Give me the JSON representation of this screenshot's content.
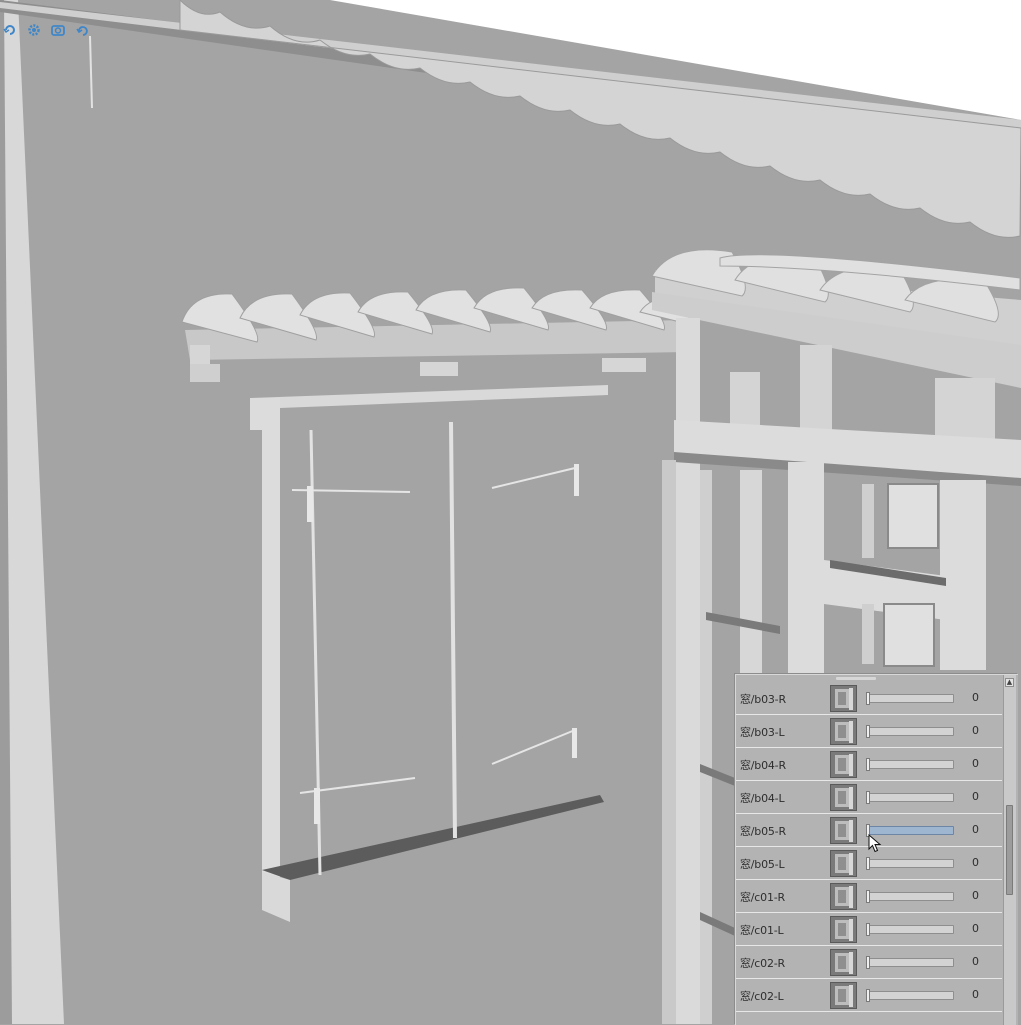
{
  "toolbar": {
    "icons": [
      "rotate-icon",
      "gear-icon",
      "camera-icon",
      "undo-icon"
    ]
  },
  "colors": {
    "accent": "#3f86c9",
    "slider_hover": "#9fb6d1",
    "wall": "#a4a4a4",
    "trim": "#dadada"
  },
  "morph_panel": {
    "items": [
      {
        "label": "窓/b03-R",
        "value": "0",
        "level": 0
      },
      {
        "label": "窓/b03-L",
        "value": "0",
        "level": 0
      },
      {
        "label": "窓/b04-R",
        "value": "0",
        "level": 0
      },
      {
        "label": "窓/b04-L",
        "value": "0",
        "level": 0
      },
      {
        "label": "窓/b05-R",
        "value": "0",
        "level": 0
      },
      {
        "label": "窓/b05-L",
        "value": "0",
        "level": 0
      },
      {
        "label": "窓/c01-R",
        "value": "0",
        "level": 0
      },
      {
        "label": "窓/c01-L",
        "value": "0",
        "level": 0
      },
      {
        "label": "窓/c02-R",
        "value": "0",
        "level": 0
      },
      {
        "label": "窓/c02-L",
        "value": "0",
        "level": 0
      }
    ]
  }
}
